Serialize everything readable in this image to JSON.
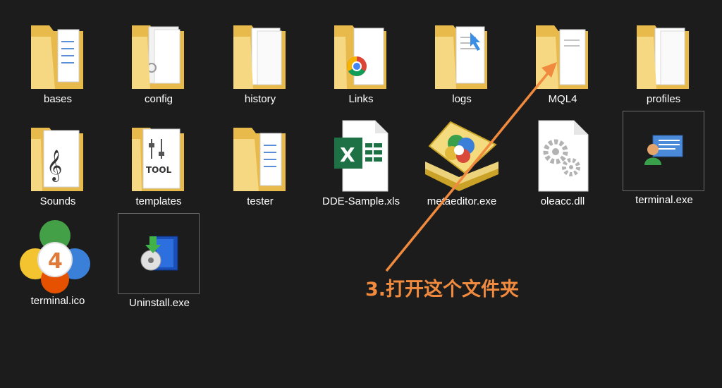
{
  "items": [
    {
      "name": "bases",
      "type": "folder"
    },
    {
      "name": "config",
      "type": "folder"
    },
    {
      "name": "history",
      "type": "folder"
    },
    {
      "name": "Links",
      "type": "folder-links"
    },
    {
      "name": "logs",
      "type": "folder"
    },
    {
      "name": "MQL4",
      "type": "folder"
    },
    {
      "name": "profiles",
      "type": "folder"
    },
    {
      "name": "Sounds",
      "type": "folder-sounds"
    },
    {
      "name": "templates",
      "type": "folder-templates"
    },
    {
      "name": "tester",
      "type": "folder"
    },
    {
      "name": "DDE-Sample.xls",
      "type": "excel-file"
    },
    {
      "name": "metaeditor.exe",
      "type": "metaeditor-exe"
    },
    {
      "name": "oleacc.dll",
      "type": "dll-file"
    },
    {
      "name": "terminal.exe",
      "type": "terminal-exe"
    },
    {
      "name": "terminal.ico",
      "type": "mt4-icon"
    },
    {
      "name": "Uninstall.exe",
      "type": "installer-exe"
    }
  ],
  "annotation": {
    "text": "3.打开这个文件夹",
    "color": "#f08a3e"
  },
  "colors": {
    "background": "#1c1c1c",
    "folder_back": "#e8b94b",
    "folder_front": "#f6d782",
    "label_text": "#ffffff"
  }
}
